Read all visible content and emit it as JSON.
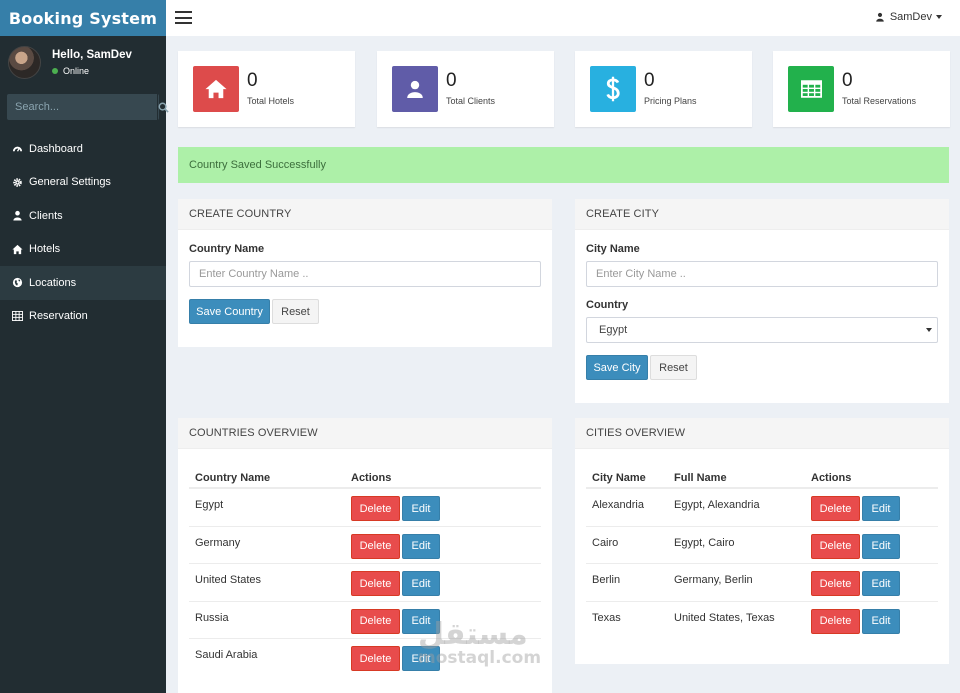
{
  "app": {
    "brand": "Booking System"
  },
  "user": {
    "greeting": "Hello, SamDev",
    "status": "Online",
    "menu_name": "SamDev"
  },
  "sidebar": {
    "search_placeholder": "Search...",
    "items": [
      {
        "label": "Dashboard",
        "icon": "dashboard-icon",
        "active": false
      },
      {
        "label": "General Settings",
        "icon": "gear-icon",
        "active": false
      },
      {
        "label": "Clients",
        "icon": "user-icon",
        "active": false
      },
      {
        "label": "Hotels",
        "icon": "home-icon",
        "active": false
      },
      {
        "label": "Locations",
        "icon": "globe-icon",
        "active": true
      },
      {
        "label": "Reservation",
        "icon": "table-icon",
        "active": false
      }
    ]
  },
  "stats": [
    {
      "value": "0",
      "label": "Total Hotels",
      "icon": "home-icon",
      "color": "#dd4b4b"
    },
    {
      "value": "0",
      "label": "Total Clients",
      "icon": "user-icon",
      "color": "#605ca8"
    },
    {
      "value": "0",
      "label": "Pricing Plans",
      "icon": "dollar-icon",
      "color": "#28b0e0"
    },
    {
      "value": "0",
      "label": "Total Reservations",
      "icon": "table-icon",
      "color": "#22b14c"
    }
  ],
  "alert": {
    "message": "Country Saved Successfully"
  },
  "create_country": {
    "title": "CREATE COUNTRY",
    "field_label": "Country Name",
    "placeholder": "Enter Country Name ..",
    "save_label": "Save Country",
    "reset_label": "Reset"
  },
  "create_city": {
    "title": "CREATE CITY",
    "city_label": "City Name",
    "city_placeholder": "Enter City Name ..",
    "country_label": "Country",
    "country_selected": "Egypt",
    "save_label": "Save City",
    "reset_label": "Reset"
  },
  "countries_overview": {
    "title": "COUNTRIES OVERVIEW",
    "columns": [
      "Country Name",
      "Actions"
    ],
    "rows": [
      "Egypt",
      "Germany",
      "United States",
      "Russia",
      "Saudi Arabia"
    ],
    "delete_label": "Delete",
    "edit_label": "Edit"
  },
  "cities_overview": {
    "title": "CITIES OVERVIEW",
    "columns": [
      "City Name",
      "Full Name",
      "Actions"
    ],
    "rows": [
      {
        "city": "Alexandria",
        "full": "Egypt, Alexandria"
      },
      {
        "city": "Cairo",
        "full": "Egypt, Cairo"
      },
      {
        "city": "Berlin",
        "full": "Germany, Berlin"
      },
      {
        "city": "Texas",
        "full": "United States, Texas"
      }
    ],
    "delete_label": "Delete",
    "edit_label": "Edit"
  },
  "watermark": {
    "arabic": "مستقل",
    "latin": "mostaql.com"
  }
}
